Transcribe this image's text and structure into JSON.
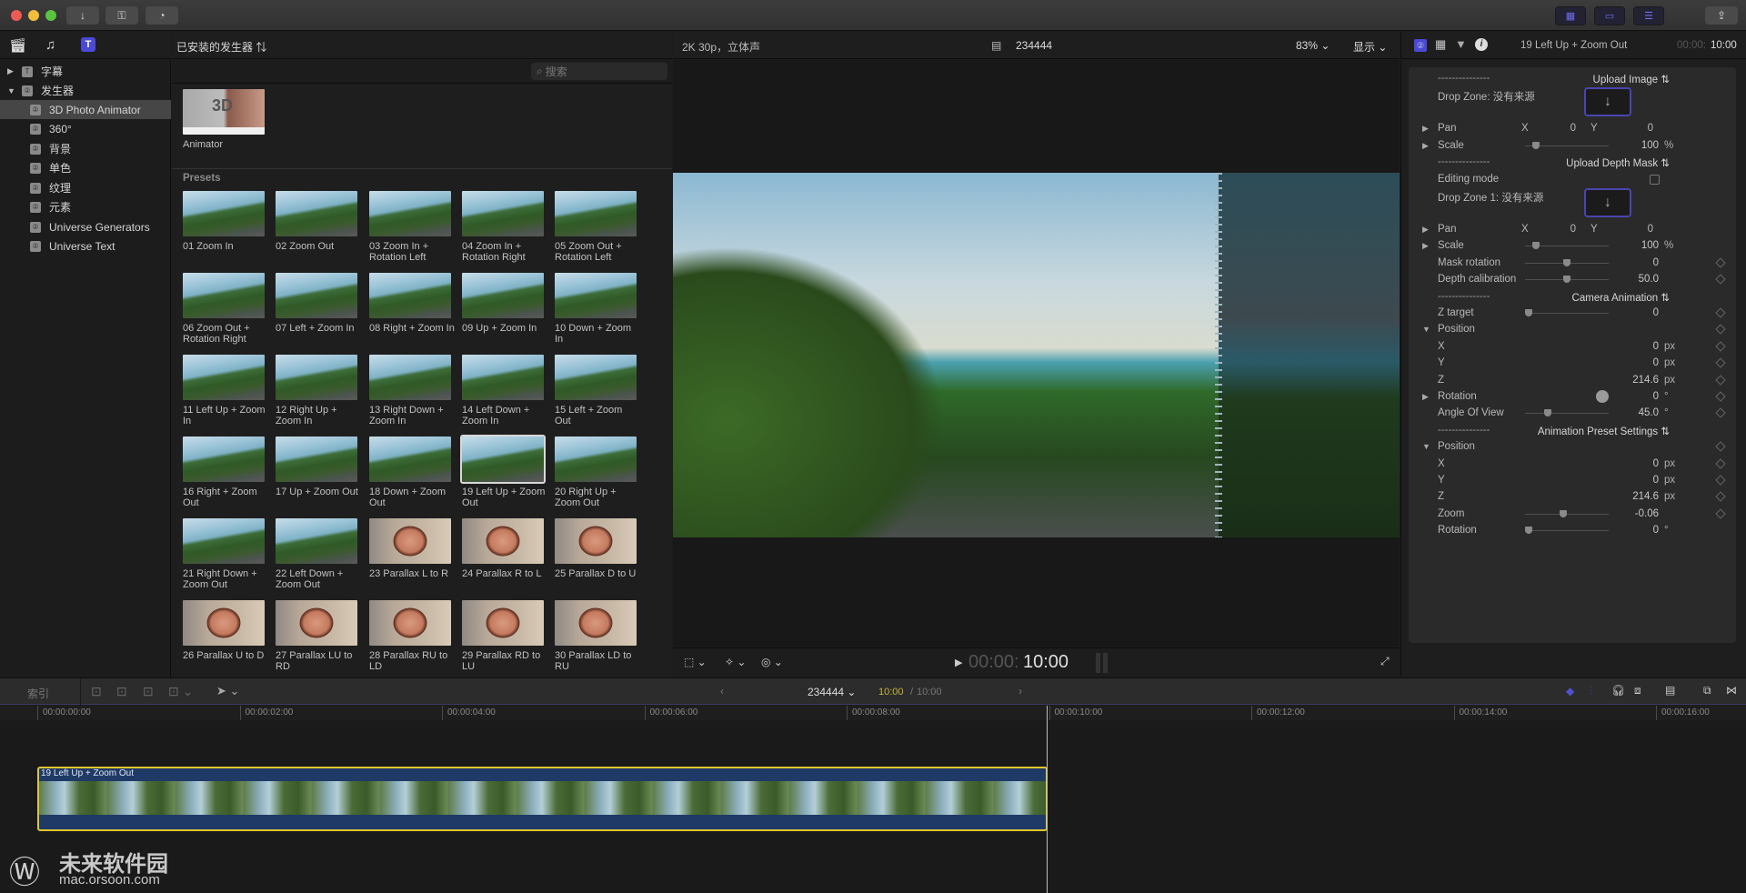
{
  "titlebar": {
    "traffic_lights": {
      "close": "#ee5b55",
      "minimize": "#f1bd3c",
      "maximize": "#5ac43f"
    },
    "left_buttons": [
      {
        "name": "import-button",
        "icon": "↓"
      },
      {
        "name": "keywords-button",
        "icon": "⚿"
      },
      {
        "name": "background-tasks-button",
        "icon": "◔"
      }
    ],
    "right_buttons": [
      {
        "name": "browser-layout-button",
        "icon": "▦"
      },
      {
        "name": "timeline-layout-button",
        "icon": "▭"
      },
      {
        "name": "inspector-layout-button",
        "icon": "☰"
      }
    ],
    "share_icon": "⇪"
  },
  "library_tabs": [
    "libraries-icon",
    "photos-audio-icon",
    "titles-generators-icon"
  ],
  "sidebar": {
    "items": [
      {
        "label": "字幕",
        "expanded": false,
        "level": 0
      },
      {
        "label": "发生器",
        "expanded": true,
        "level": 0
      },
      {
        "label": "3D Photo Animator",
        "level": 1,
        "selected": true
      },
      {
        "label": "360°",
        "level": 1
      },
      {
        "label": "背景",
        "level": 1
      },
      {
        "label": "单色",
        "level": 1
      },
      {
        "label": "纹理",
        "level": 1
      },
      {
        "label": "元素",
        "level": 1
      },
      {
        "label": "Universe Generators",
        "level": 1
      },
      {
        "label": "Universe Text",
        "level": 1
      }
    ]
  },
  "browser": {
    "header": "已安装的发生器",
    "search_placeholder": "搜索",
    "top_item": {
      "label": "Animator",
      "thumb_text": "3D"
    },
    "section_label": "Presets",
    "presets": [
      {
        "label": "01 Zoom In",
        "kind": "land"
      },
      {
        "label": "02 Zoom Out",
        "kind": "land"
      },
      {
        "label": "03 Zoom In + Rotation Left",
        "kind": "land"
      },
      {
        "label": "04 Zoom In + Rotation Right",
        "kind": "land"
      },
      {
        "label": "05 Zoom Out + Rotation Left",
        "kind": "land"
      },
      {
        "label": "06 Zoom Out + Rotation Right",
        "kind": "land"
      },
      {
        "label": "07 Left + Zoom In",
        "kind": "land"
      },
      {
        "label": "08 Right + Zoom In",
        "kind": "land"
      },
      {
        "label": "09 Up + Zoom In",
        "kind": "land"
      },
      {
        "label": "10 Down + Zoom In",
        "kind": "land"
      },
      {
        "label": "11 Left Up + Zoom In",
        "kind": "land"
      },
      {
        "label": "12 Right Up + Zoom In",
        "kind": "land"
      },
      {
        "label": "13 Right Down + Zoom In",
        "kind": "land"
      },
      {
        "label": "14 Left Down + Zoom In",
        "kind": "land"
      },
      {
        "label": "15 Left + Zoom Out",
        "kind": "land"
      },
      {
        "label": "16 Right + Zoom Out",
        "kind": "land"
      },
      {
        "label": "17 Up + Zoom Out",
        "kind": "land"
      },
      {
        "label": "18 Down + Zoom Out",
        "kind": "land"
      },
      {
        "label": "19 Left Up + Zoom Out",
        "kind": "land",
        "selected": true
      },
      {
        "label": "20 Right Up + Zoom Out",
        "kind": "land"
      },
      {
        "label": "21 Right Down + Zoom Out",
        "kind": "land"
      },
      {
        "label": "22 Left Down + Zoom Out",
        "kind": "land"
      },
      {
        "label": "23 Parallax L to R",
        "kind": "face"
      },
      {
        "label": "24 Parallax R to L",
        "kind": "face"
      },
      {
        "label": "25 Parallax D to U",
        "kind": "face"
      },
      {
        "label": "26 Parallax U to D",
        "kind": "face"
      },
      {
        "label": "27 Parallax LU to RD",
        "kind": "face"
      },
      {
        "label": "28 Parallax RU to LD",
        "kind": "face"
      },
      {
        "label": "29 Parallax RD to LU",
        "kind": "face"
      },
      {
        "label": "30 Parallax LD to RU",
        "kind": "face"
      }
    ]
  },
  "viewer": {
    "format": "2K 30p，立体声",
    "project_name": "234444",
    "zoom": "83%",
    "display_menu": "显示",
    "timecode_dim": "00:00:",
    "timecode": "10:00",
    "tools": [
      "transform-tool",
      "enhance-tool",
      "retime-tool"
    ]
  },
  "inspector": {
    "tabs": [
      "generator-tab",
      "video-tab",
      "color-tab",
      "info-tab"
    ],
    "title": "19 Left Up + Zoom Out",
    "duration_dim": "00:00:",
    "duration": "10:00",
    "rows": [
      {
        "type": "popup",
        "dash": "---------------",
        "label": "Upload Image"
      },
      {
        "type": "drop",
        "label": "Drop Zone: 没有来源"
      },
      {
        "type": "xy",
        "label": "Pan",
        "x": "0",
        "y": "0",
        "tri": "▶"
      },
      {
        "type": "slider",
        "label": "Scale",
        "value": "100",
        "unit": "%",
        "tri": "▶",
        "pos": 0.1
      },
      {
        "type": "popup",
        "dash": "---------------",
        "label": "Upload Depth Mask"
      },
      {
        "type": "check",
        "label": "Editing mode",
        "checked": false
      },
      {
        "type": "drop",
        "label": "Drop Zone 1: 没有来源"
      },
      {
        "type": "xy",
        "label": "Pan",
        "x": "0",
        "y": "0",
        "tri": "▶"
      },
      {
        "type": "slider",
        "label": "Scale",
        "value": "100",
        "unit": "%",
        "tri": "▶",
        "pos": 0.1
      },
      {
        "type": "slider",
        "label": "Mask rotation",
        "value": "0",
        "pos": 0.5,
        "kf": true
      },
      {
        "type": "slider",
        "label": "Depth calibration",
        "value": "50.0",
        "pos": 0.5,
        "kf": true
      },
      {
        "type": "popup",
        "dash": "---------------",
        "label": "Camera Animation"
      },
      {
        "type": "slider",
        "label": "Z target",
        "value": "0",
        "pos": 0.0,
        "kf": true
      },
      {
        "type": "group",
        "label": "Position",
        "tri": "▼",
        "kf": true
      },
      {
        "type": "value",
        "label": "X",
        "value": "0",
        "unit": "px",
        "kf": true
      },
      {
        "type": "value",
        "label": "Y",
        "value": "0",
        "unit": "px",
        "kf": true
      },
      {
        "type": "value",
        "label": "Z",
        "value": "214.6",
        "unit": "px",
        "kf": true
      },
      {
        "type": "dial",
        "label": "Rotation",
        "value": "0",
        "unit": "°",
        "tri": "▶",
        "kf": true
      },
      {
        "type": "slider",
        "label": "Angle Of View",
        "value": "45.0",
        "unit": "°",
        "pos": 0.25,
        "kf": true
      },
      {
        "type": "popup",
        "dash": "---------------",
        "label": "Animation Preset Settings"
      },
      {
        "type": "group",
        "label": "Position",
        "tri": "▼",
        "kf": true
      },
      {
        "type": "value",
        "label": "X",
        "value": "0",
        "unit": "px",
        "kf": true
      },
      {
        "type": "value",
        "label": "Y",
        "value": "0",
        "unit": "px",
        "kf": true
      },
      {
        "type": "value",
        "label": "Z",
        "value": "214.6",
        "unit": "px",
        "kf": true
      },
      {
        "type": "slider",
        "label": "Zoom",
        "value": "-0.06",
        "pos": 0.45,
        "kf": true
      },
      {
        "type": "slider",
        "label": "Rotation",
        "value": "0",
        "unit": "°",
        "pos": 0.0
      }
    ]
  },
  "timeline": {
    "index_label": "索引",
    "project_name": "234444",
    "position": "10:00",
    "separator": "/",
    "duration": "10:00",
    "ruler_ticks": [
      "00:00:00:00",
      "00:00:02:00",
      "00:00:04:00",
      "00:00:06:00",
      "00:00:08:00",
      "00:00:10:00",
      "00:00:12:00",
      "00:00:14:00",
      "00:00:16:00"
    ],
    "clip_title": "19 Left Up + Zoom Out",
    "accent_color": "#e0c530",
    "clip_color": "#1f3a66"
  },
  "watermark": {
    "title": "未来软件园",
    "url": "mac.orsoon.com"
  }
}
